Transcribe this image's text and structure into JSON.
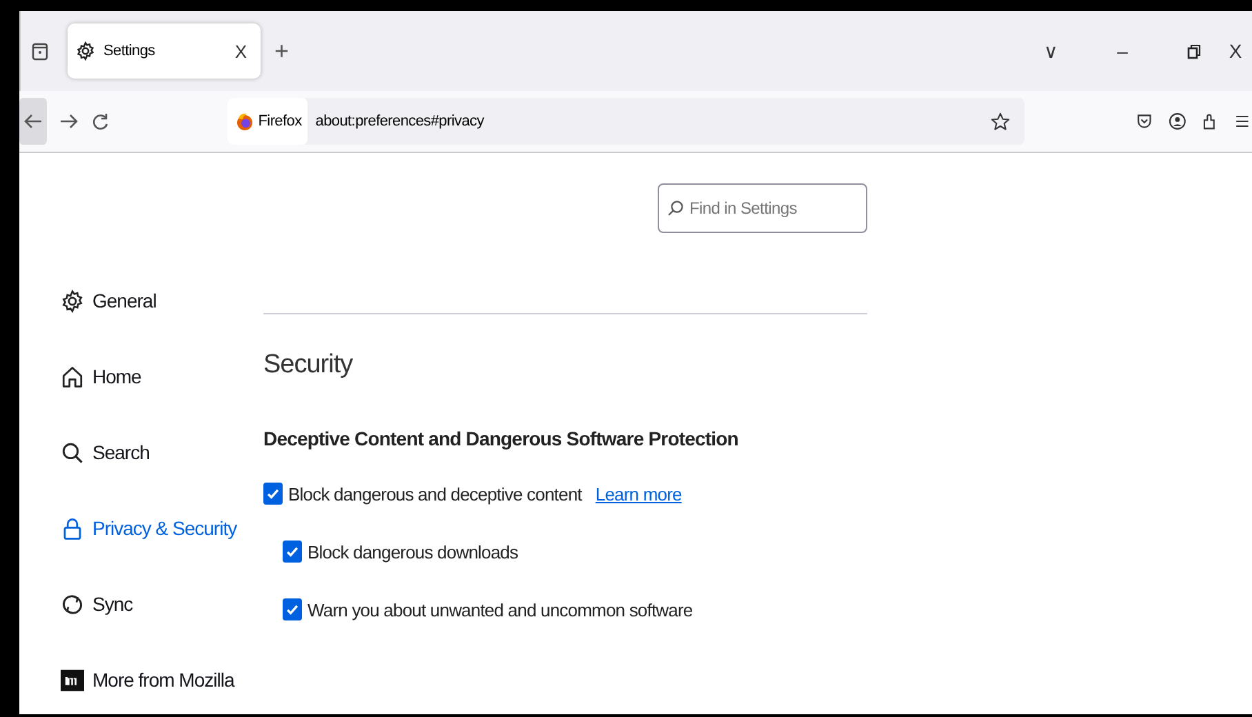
{
  "tabs": [
    {
      "label": "Settings",
      "selected": true,
      "close": "X"
    }
  ],
  "new_tab": "+",
  "tab_list": "∨",
  "window_controls": {
    "minimize": "–",
    "close": "X"
  },
  "address_bar": {
    "identity": "Firefox",
    "url": "about:preferences#privacy"
  },
  "search": {
    "placeholder": "Find in Settings"
  },
  "sidebar": {
    "items": [
      {
        "label": "General",
        "kind": "gear",
        "selected": false
      },
      {
        "label": "Home",
        "kind": "home",
        "selected": false
      },
      {
        "label": "Search",
        "kind": "search",
        "selected": false
      },
      {
        "label": "Privacy & Security",
        "kind": "lock",
        "selected": true
      },
      {
        "label": "Sync",
        "kind": "sync",
        "selected": false
      },
      {
        "label": "More from Mozilla",
        "kind": "mozilla",
        "selected": false
      }
    ]
  },
  "section": {
    "title": "Security",
    "subtitle": "Deceptive Content and Dangerous Software Protection",
    "options": [
      {
        "label": "Block dangerous and deceptive content",
        "checked": true,
        "link": "Learn more",
        "children": [
          {
            "label": "Block dangerous downloads",
            "checked": true
          },
          {
            "label": "Warn you about unwanted and uncommon software",
            "checked": true
          }
        ]
      }
    ]
  }
}
